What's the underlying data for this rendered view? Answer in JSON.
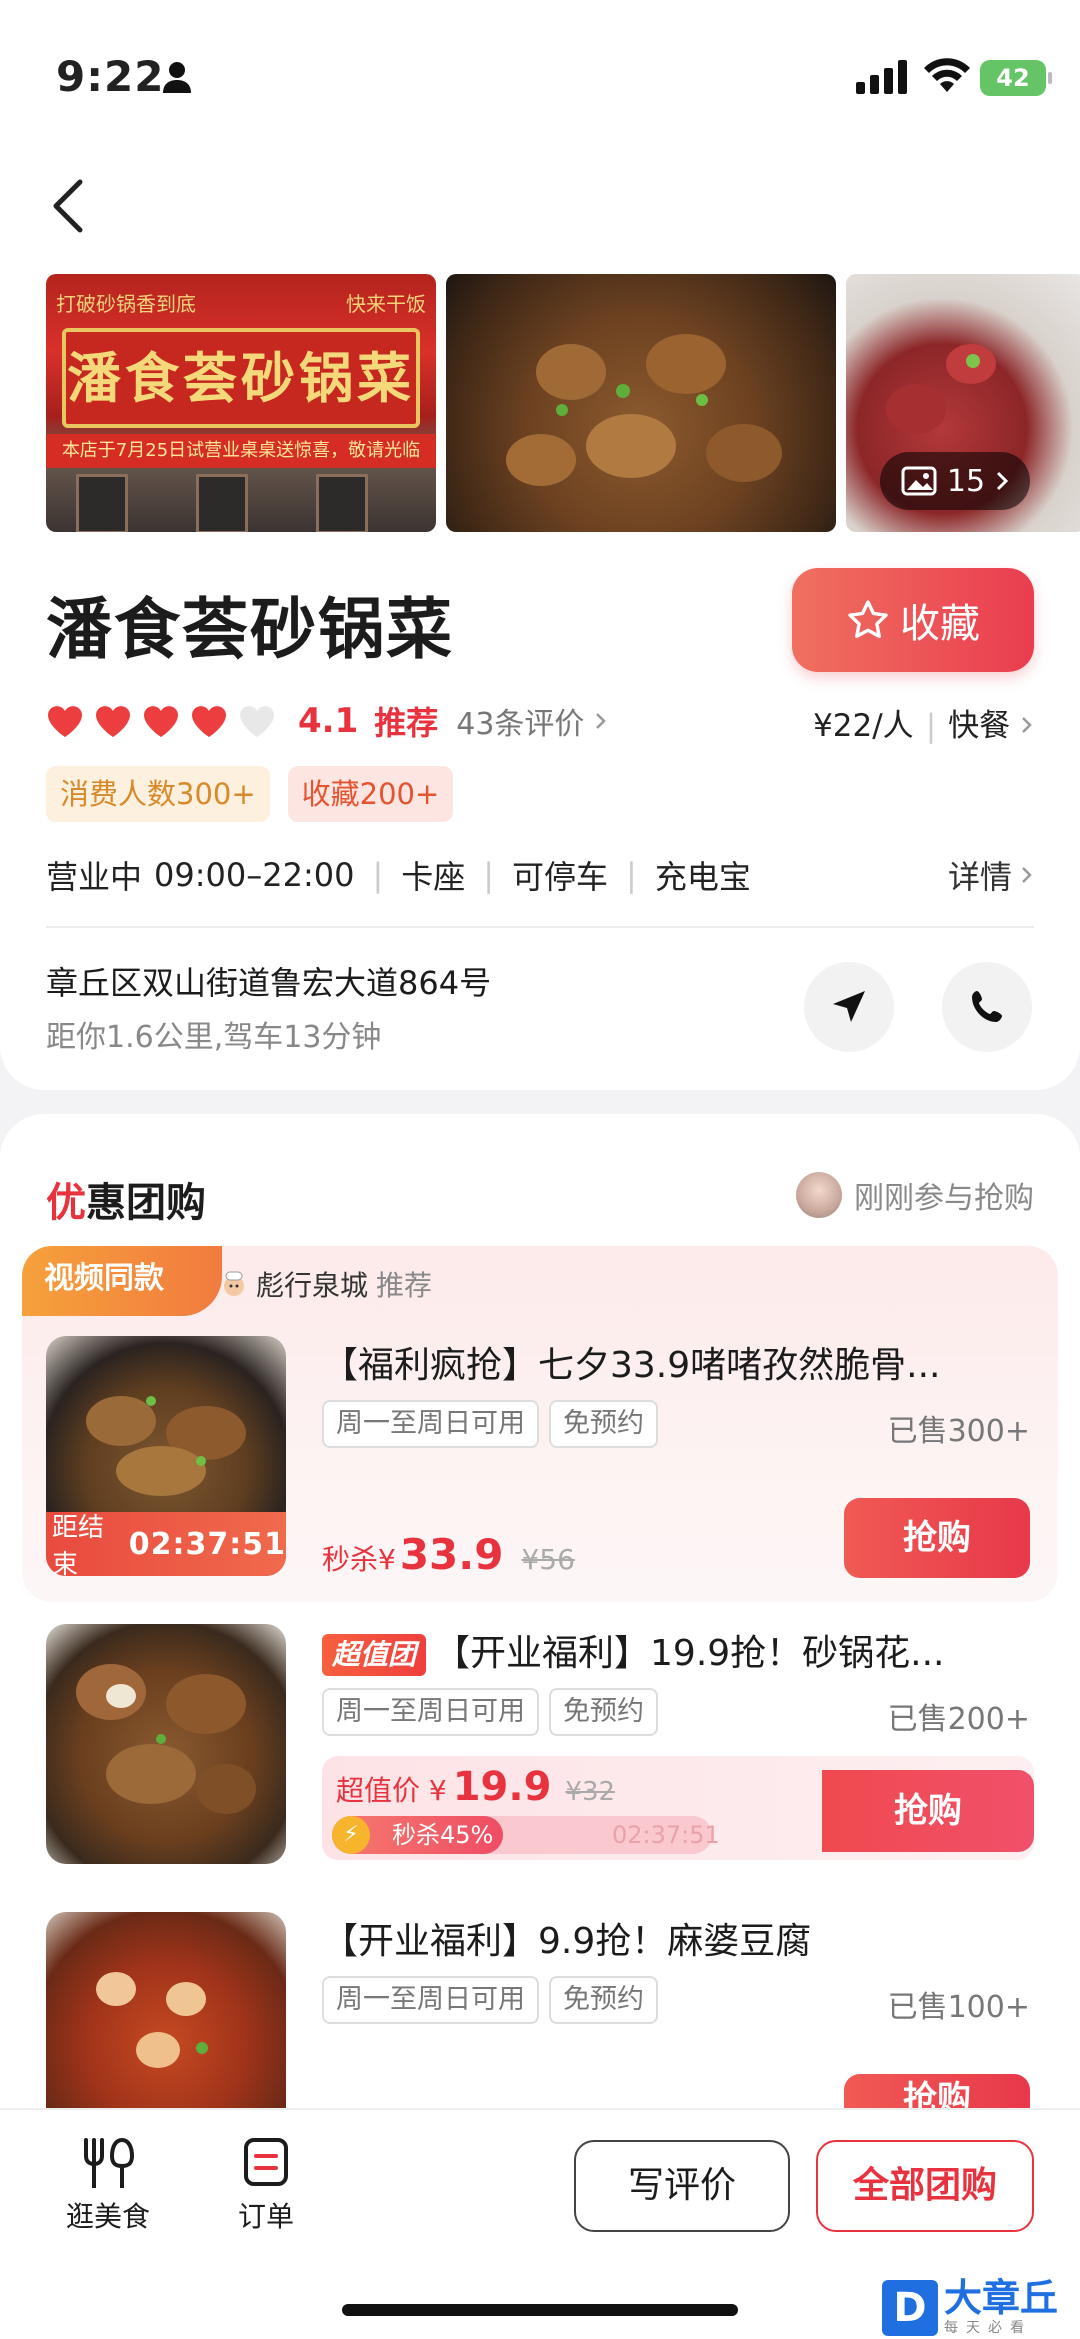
{
  "status": {
    "time": "9:22",
    "battery": "42"
  },
  "shop": {
    "name": "潘食荟砂锅菜",
    "fav_label": "收藏",
    "rating": "4.1",
    "rec_label": "推荐",
    "reviews": "43条评价",
    "price": "¥22/人",
    "category": "快餐",
    "tag1": "消费人数300+",
    "tag2": "收藏200+",
    "status_open": "营业中",
    "hours": "09:00–22:00",
    "facility1": "卡座",
    "facility2": "可停车",
    "facility3": "充电宝",
    "detail_label": "详情",
    "address": "章丘区双山街道鲁宏大道864号",
    "distance": "距你1.6公里,驾车13分钟"
  },
  "photos": {
    "count": "15",
    "sign_text": "潘食荟砂锅菜",
    "sign_top_left": "打破砂锅香到底",
    "sign_top_right": "快来干饭",
    "sign_strip": "本店于7月25日试营业桌桌送惊喜，敬请光临"
  },
  "group": {
    "section_title_first": "优",
    "section_title_rest": "惠团购",
    "recent_label": "刚刚参与抢购",
    "video_tag": "视频同款",
    "author": "彪行泉城",
    "author_rec": "推荐",
    "deals": [
      {
        "title": "【福利疯抢】七夕33.9啫啫孜然脆骨...",
        "chip1": "周一至周日可用",
        "chip2": "免预约",
        "sold": "已售300+",
        "price_prefix": "秒杀¥",
        "price": "33.9",
        "old_price": "¥56",
        "countdown_label": "距结束",
        "countdown": "02:37:51",
        "buy_label": "抢购"
      },
      {
        "badge": "超值团",
        "title": "【开业福利】19.9抢！砂锅花...",
        "chip1": "周一至周日可用",
        "chip2": "免预约",
        "sold": "已售200+",
        "price_prefix": "超值价 ¥",
        "price": "19.9",
        "old_price": "¥32",
        "progress_label": "秒杀45%",
        "progress": 0.45,
        "countdown": "02:37:51",
        "buy_label": "抢购"
      },
      {
        "title": "【开业福利】9.9抢！麻婆豆腐",
        "chip1": "周一至周日可用",
        "chip2": "免预约",
        "sold": "已售100+",
        "buy_label": "抢购"
      }
    ]
  },
  "bottom": {
    "tab1": "逛美食",
    "tab2": "订单",
    "write_review": "写评价",
    "all_group": "全部团购"
  },
  "watermark": {
    "main": "大章丘",
    "sub": "每天必看"
  },
  "colors": {
    "accent": "#e8333f",
    "orange": "#f17b3f"
  }
}
